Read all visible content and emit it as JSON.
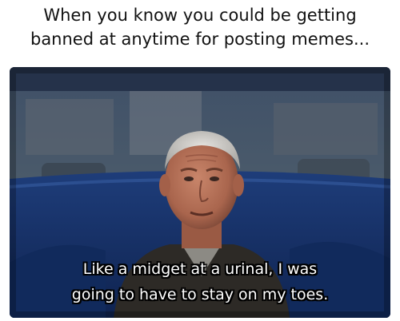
{
  "caption": {
    "line1": "When you know you could be getting",
    "line2": "banned at anytime for posting memes..."
  },
  "subtitle": {
    "line1": "Like a midget at a urinal, I was",
    "line2": "going to have to stay on my toes."
  }
}
